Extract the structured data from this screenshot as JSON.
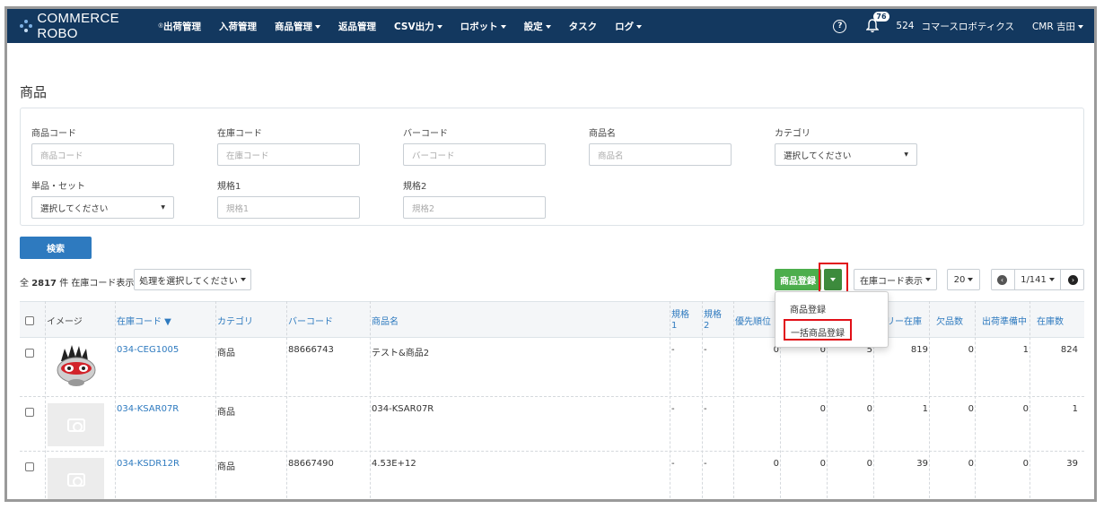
{
  "nav": {
    "brand": "COMMERCE ROBO",
    "brand_mark": "®",
    "items": [
      {
        "label": "出荷管理",
        "dropdown": false
      },
      {
        "label": "入荷管理",
        "dropdown": false
      },
      {
        "label": "商品管理",
        "dropdown": true
      },
      {
        "label": "返品管理",
        "dropdown": false
      },
      {
        "label": "CSV出力",
        "dropdown": true
      },
      {
        "label": "ロボット",
        "dropdown": true
      },
      {
        "label": "設定",
        "dropdown": true
      },
      {
        "label": "タスク",
        "dropdown": false
      },
      {
        "label": "ログ",
        "dropdown": true
      }
    ],
    "help_icon": "?",
    "notification_count": "76",
    "account_id": "524",
    "company": "コマースロボティクス",
    "user": "CMR 吉田"
  },
  "page": {
    "title": "商品"
  },
  "filters": {
    "product_code": {
      "label": "商品コード",
      "placeholder": "商品コード"
    },
    "stock_code": {
      "label": "在庫コード",
      "placeholder": "在庫コード"
    },
    "barcode": {
      "label": "バーコード",
      "placeholder": "バーコード"
    },
    "product_name": {
      "label": "商品名",
      "placeholder": "商品名"
    },
    "category": {
      "label": "カテゴリ",
      "value": "選択してください"
    },
    "single_set": {
      "label": "単品・セット",
      "value": "選択してください"
    },
    "spec1": {
      "label": "規格1",
      "placeholder": "規格1"
    },
    "spec2": {
      "label": "規格2",
      "placeholder": "規格2"
    }
  },
  "search_button": "検索",
  "toolbar": {
    "total_prefix": "全",
    "total_count": "2817",
    "total_suffix": "件 在庫コード表示",
    "bulk_action": "処理を選択してください",
    "register_button": "商品登録",
    "display_mode": "在庫コード表示",
    "per_page": "20",
    "page_indicator": "1/141"
  },
  "register_menu": {
    "items": [
      "商品登録",
      "一括商品登録"
    ]
  },
  "table": {
    "headers": {
      "image": "イメージ",
      "stock_code": "在庫コード ▼",
      "category": "カテゴリ",
      "barcode": "バーコード",
      "name": "商品名",
      "spec1_a": "規格",
      "spec1_b": "1",
      "spec2_a": "規格",
      "spec2_b": "2",
      "priority": "優先順位",
      "free_stock": "リー在庫",
      "shortage": "欠品数",
      "preparing": "出荷準備中",
      "stock": "在庫数"
    },
    "rows": [
      {
        "stock_code": "034-CEG1005",
        "category": "商品",
        "barcode": "88666743",
        "name": "テスト&商品2",
        "spec1": "-",
        "spec2": "-",
        "priority": "0",
        "c1": "0",
        "c2": "5",
        "free_stock": "819",
        "shortage": "0",
        "preparing": "1",
        "stock": "824",
        "image": "robot-mascot"
      },
      {
        "stock_code": "034-KSAR07R",
        "category": "商品",
        "barcode": "",
        "name": "034-KSAR07R",
        "spec1": "-",
        "spec2": "-",
        "priority": "",
        "c1": "0",
        "c2": "0",
        "free_stock": "1",
        "shortage": "0",
        "preparing": "0",
        "stock": "1",
        "image": "placeholder"
      },
      {
        "stock_code": "034-KSDR12R",
        "category": "商品",
        "barcode": "88667490",
        "name": "4.53E+12",
        "spec1": "-",
        "spec2": "-",
        "priority": "0",
        "c1": "0",
        "c2": "0",
        "free_stock": "39",
        "shortage": "0",
        "preparing": "0",
        "stock": "39",
        "image": "placeholder"
      }
    ]
  },
  "colors": {
    "nav_bg": "#13385f",
    "accent": "#2e7abf",
    "green": "#4cae4c",
    "highlight": "#e10f17"
  }
}
